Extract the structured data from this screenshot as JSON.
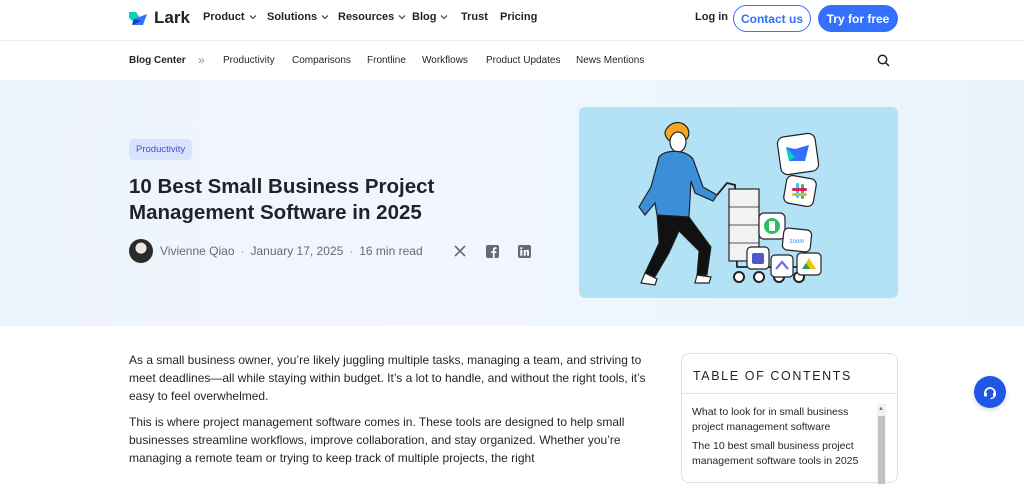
{
  "topnav": {
    "logo_text": "Lark",
    "items": [
      {
        "label": "Product",
        "dropdown": true
      },
      {
        "label": "Solutions",
        "dropdown": true
      },
      {
        "label": "Resources",
        "dropdown": true
      },
      {
        "label": "Blog",
        "dropdown": true
      },
      {
        "label": "Trust",
        "dropdown": false
      },
      {
        "label": "Pricing",
        "dropdown": false
      }
    ],
    "login": "Log in",
    "contact": "Contact us",
    "try": "Try for free"
  },
  "subnav": {
    "home": "Blog Center",
    "separator": "»",
    "items": [
      "Productivity",
      "Comparisons",
      "Frontline",
      "Workflows",
      "Product Updates",
      "News Mentions"
    ]
  },
  "hero": {
    "tag": "Productivity",
    "title": "10 Best Small Business Project Management Software in 2025",
    "author": "Vivienne Qiao",
    "date": "January 17, 2025",
    "read_time": "16 min read",
    "dot": "·",
    "share_icons": [
      "x-icon",
      "facebook-icon",
      "linkedin-icon"
    ]
  },
  "content": {
    "p1": "As a small business owner, you’re likely juggling multiple tasks, managing a team, and striving to meet deadlines—all while staying within budget. It’s a lot to handle, and without the right tools, it’s easy to feel overwhelmed.",
    "p2": "This is where project management software comes in. These tools are designed to help small businesses streamline workflows, improve collaboration, and stay organized. Whether you’re managing a remote team or trying to keep track of multiple projects, the right"
  },
  "toc": {
    "title": "TABLE OF CONTENTS",
    "items": [
      "What to look for in small business project management software",
      "The 10 best small business project management software tools in 2025"
    ]
  },
  "illustration": {
    "zoom_label": "zoom"
  },
  "colors": {
    "accent": "#3370ff",
    "hero_bg": "#eef4fb",
    "illustration_bg": "#b3e2f7"
  }
}
